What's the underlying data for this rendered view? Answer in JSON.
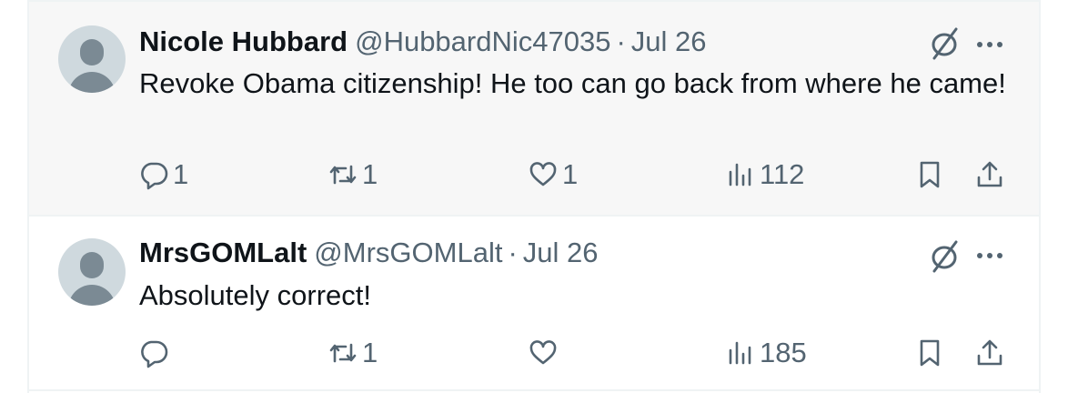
{
  "tweets": [
    {
      "name": "Nicole Hubbard",
      "handle": "@HubbardNic47035",
      "separator": "·",
      "date": "Jul 26",
      "text": "Revoke Obama citizenship!  He too can go back from where he came!",
      "replies": "1",
      "retweets": "1",
      "likes": "1",
      "views": "112"
    },
    {
      "name": "MrsGOMLalt",
      "handle": "@MrsGOMLalt",
      "separator": "·",
      "date": "Jul 26",
      "text": "Absolutely correct!",
      "replies": "",
      "retweets": "1",
      "likes": "",
      "views": "185"
    }
  ],
  "icons": {
    "reply": "reply-icon",
    "retweet": "retweet-icon",
    "like": "heart-icon",
    "views": "views-icon",
    "bookmark": "bookmark-icon",
    "share": "share-icon",
    "grok": "grok-icon",
    "more": "more-icon"
  },
  "colors": {
    "text": "#0f1419",
    "muted": "#536471",
    "highlight_bg": "#f7f7f7",
    "avatar_bg": "#cfd9de",
    "avatar_fg": "#7b8a94"
  }
}
